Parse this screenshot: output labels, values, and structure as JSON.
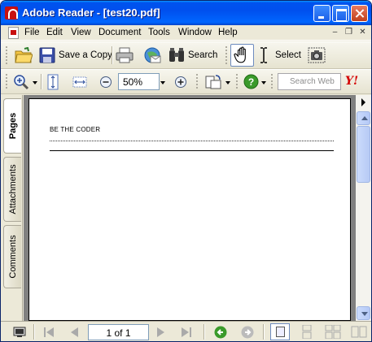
{
  "window": {
    "title": "Adobe Reader - [test20.pdf]"
  },
  "menu": {
    "items": [
      "File",
      "Edit",
      "View",
      "Document",
      "Tools",
      "Window",
      "Help"
    ]
  },
  "toolbar": {
    "save_copy_label": "Save a Copy",
    "search_label": "Search",
    "select_label": "Select",
    "zoom_value": "50%",
    "search_web_placeholder": "Search Web"
  },
  "nav_tabs": [
    "Pages",
    "Attachments",
    "Comments"
  ],
  "document": {
    "text": "BE THE CODER"
  },
  "status": {
    "page_indicator": "1 of 1"
  },
  "colors": {
    "title_bar": "#0054e3",
    "page_background": "#808080",
    "go_back_green": "#3a9a2a"
  },
  "icons": [
    "folder-icon",
    "save-icon",
    "print-icon",
    "email-icon",
    "binoculars-icon",
    "hand-tool-icon",
    "select-cursor-icon",
    "snapshot-icon",
    "zoom-icon",
    "fit-page-icon",
    "fit-width-icon",
    "zoom-out-icon",
    "zoom-in-icon",
    "rotate-icon",
    "help-icon",
    "yahoo-icon"
  ]
}
